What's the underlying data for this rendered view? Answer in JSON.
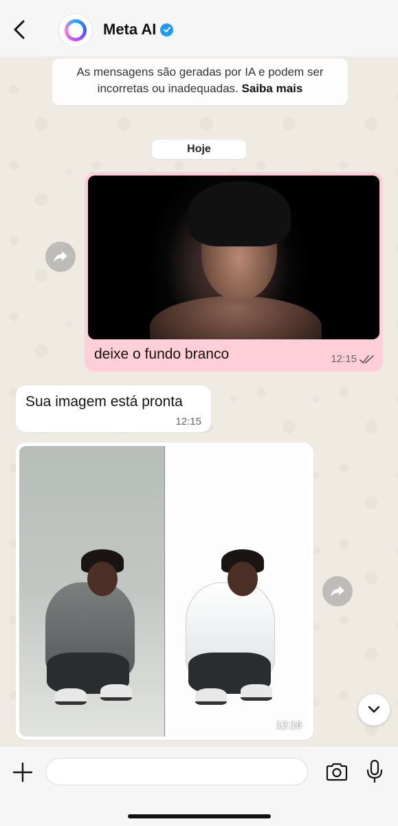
{
  "header": {
    "contact_name": "Meta AI",
    "verified": true
  },
  "disclaimer": {
    "text": "As mensagens são geradas por IA e podem ser incorretas ou inadequadas.",
    "link": "Saiba mais"
  },
  "date_pill": "Hoje",
  "messages": [
    {
      "direction": "outgoing",
      "type": "image",
      "caption": "deixe o fundo branco",
      "time": "12:15",
      "status": "read"
    },
    {
      "direction": "incoming",
      "type": "text",
      "text": "Sua imagem está pronta",
      "time": "12:15"
    },
    {
      "direction": "incoming",
      "type": "image",
      "time": "12:16"
    }
  ],
  "composer": {
    "placeholder": ""
  },
  "colors": {
    "outgoing_bubble": "#fecfd8",
    "incoming_bubble": "#ffffff",
    "verified_badge": "#1d9bf0"
  }
}
